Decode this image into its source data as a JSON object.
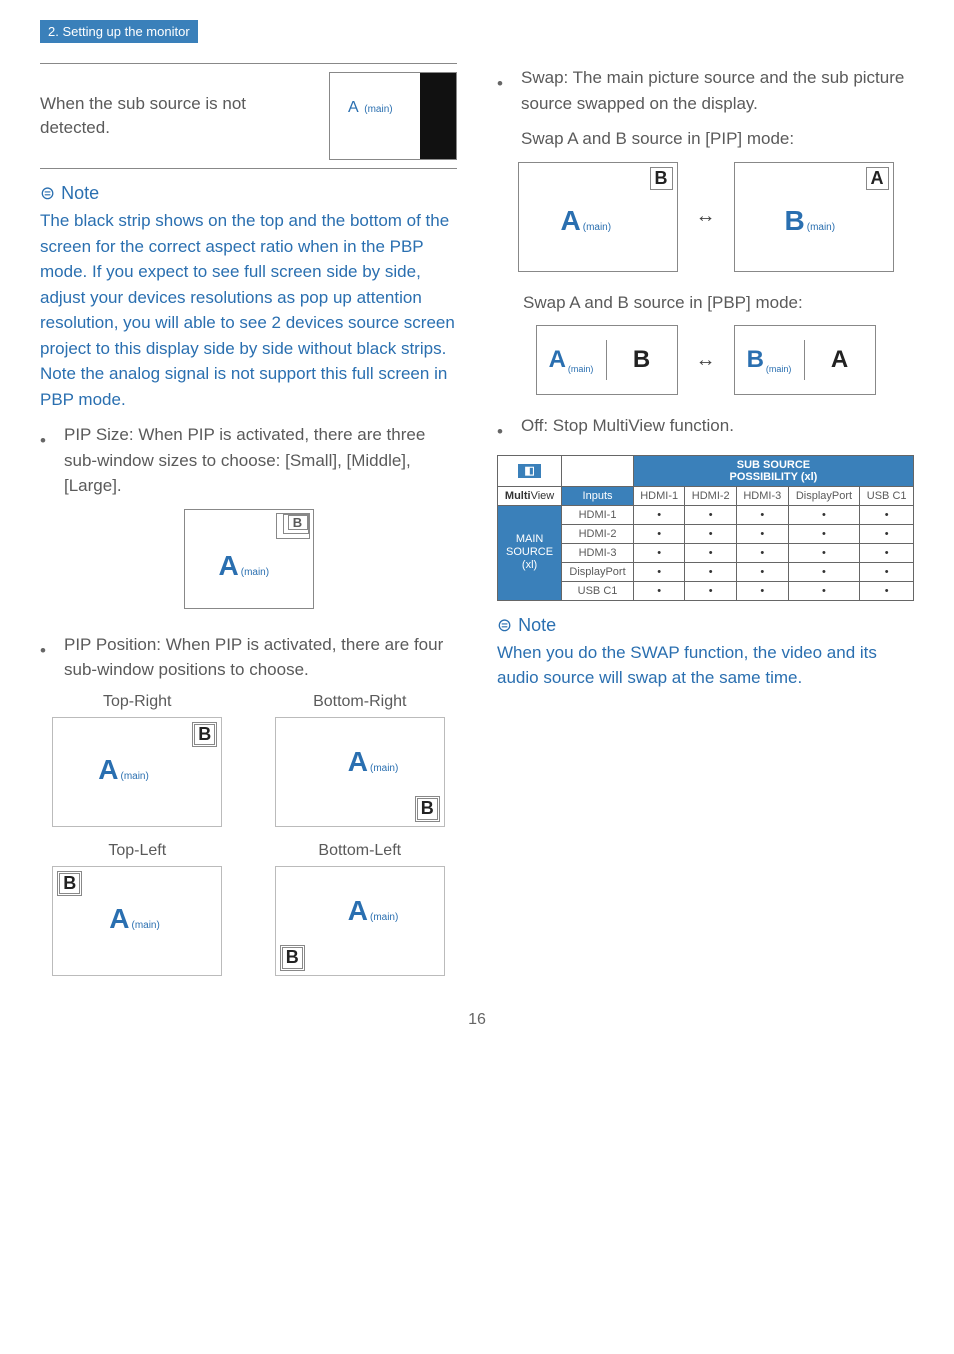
{
  "chapter_tab": "2. Setting up the monitor",
  "page_number": "16",
  "left": {
    "detect_text": "When the sub source is not detected.",
    "A_main": "A",
    "main_suffix": "(main)",
    "note_label": "Note",
    "note_body": "The black strip shows on the top and the bottom of the screen for the correct aspect ratio when in the PBP mode. If you expect to see full screen side by side, adjust your devices resolutions as pop up attention resolution, you will able to see 2 devices source screen project to this display side by side without black strips. Note the analog signal is not support this full screen in PBP mode.",
    "pip_size_text": "PIP Size: When PIP is activated, there are three sub-window sizes to choose: [Small], [Middle], [Large].",
    "B_label": "B",
    "pip_pos_text": "PIP Position: When PIP is activated, there are four sub-window positions to choose.",
    "pos": {
      "tr": "Top-Right",
      "br": "Bottom-Right",
      "tl": "Top-Left",
      "bl": "Bottom-Left"
    }
  },
  "right": {
    "swap_text": "Swap: The main picture source and the sub picture source swapped on the display.",
    "swap_pip_caption": "Swap A and B source in [PIP] mode:",
    "swap_pbp_caption": "Swap A and B source in [PBP] mode:",
    "A": "A",
    "B": "B",
    "main_suffix": "(main)",
    "arrow": "↔",
    "off_text": "Off: Stop MultiView function.",
    "table": {
      "sub_header": "SUB SOURCE\nPOSSIBILITY (xl)",
      "mv_label": "MultiView",
      "inputs_label": "Inputs",
      "cols": [
        "HDMI-1",
        "HDMI-2",
        "HDMI-3",
        "DisplayPort",
        "USB C1"
      ],
      "main_src_label": "MAIN SOURCE (xl)",
      "rows": [
        "HDMI-1",
        "HDMI-2",
        "HDMI-3",
        "DisplayPort",
        "USB C1"
      ]
    },
    "note_label": "Note",
    "note_body": "When you do the SWAP function, the video and its audio source will swap at the same time."
  }
}
